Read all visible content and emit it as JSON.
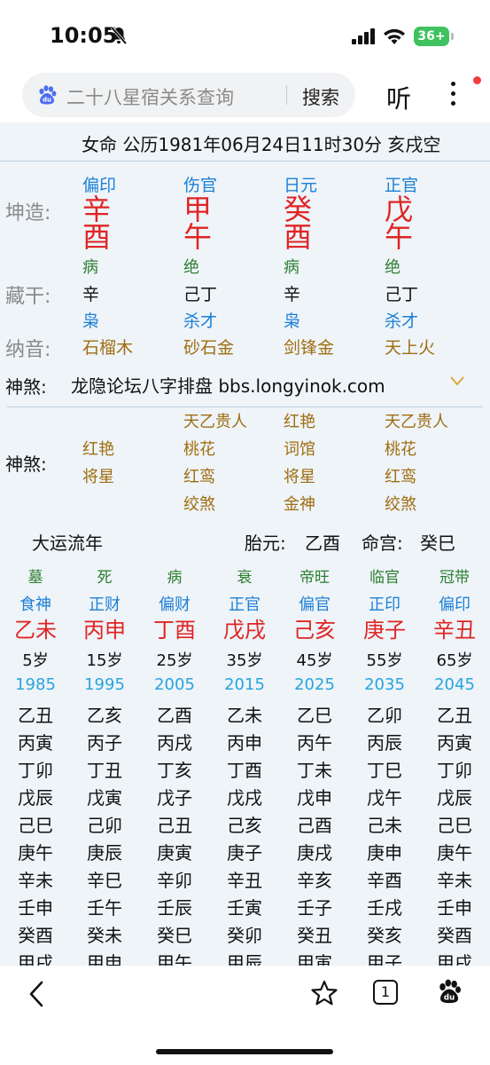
{
  "status": {
    "time": "10:05",
    "battery": "36+"
  },
  "browser": {
    "search_text": "二十八星宿关系查询",
    "search_btn": "搜索",
    "listen_btn": "听"
  },
  "header": "女命 公历1981年06月24日11时30分 亥戌空",
  "pillars": [
    {
      "ten_god": "偏印",
      "stem": "辛",
      "branch": "酉",
      "stage": "病",
      "hidden": "辛",
      "hidden_gods": "枭",
      "nayin": "石榴木"
    },
    {
      "ten_god": "伤官",
      "stem": "甲",
      "branch": "午",
      "stage": "绝",
      "hidden": "己丁",
      "hidden_gods": "杀才",
      "nayin": "砂石金"
    },
    {
      "ten_god": "日元",
      "stem": "癸",
      "branch": "酉",
      "stage": "病",
      "hidden": "辛",
      "hidden_gods": "枭",
      "nayin": "剑锋金"
    },
    {
      "ten_god": "正官",
      "stem": "戊",
      "branch": "午",
      "stage": "绝",
      "hidden": "己丁",
      "hidden_gods": "杀才",
      "nayin": "天上火"
    }
  ],
  "labels": {
    "kunzao": "坤造:",
    "canggan": "藏干:",
    "nayin": "纳音:",
    "shensha": "神煞:",
    "shensha2": "神煞:"
  },
  "shensha_line": "龙隐论坛八字排盘 bbs.longyinok.com",
  "shensha_cols": [
    [
      "红艳",
      "将星"
    ],
    [
      "天乙贵人",
      "桃花",
      "红鸾",
      "绞煞"
    ],
    [
      "红艳",
      "词馆",
      "将星",
      "金神"
    ],
    [
      "天乙贵人",
      "桃花",
      "红鸾",
      "绞煞"
    ]
  ],
  "dayun": {
    "title": "大运流年",
    "taiyuan_label": "胎元:",
    "taiyuan": "乙酉",
    "minggong_label": "命宫:",
    "minggong": "癸巳"
  },
  "dayun_cols": [
    {
      "stage": "墓",
      "god": "食神",
      "ganzhi": "乙未",
      "age": "5岁",
      "year": "1985",
      "years": [
        "乙丑",
        "丙寅",
        "丁卯",
        "戊辰",
        "己巳",
        "庚午",
        "辛未",
        "壬申",
        "癸酉",
        "甲戌"
      ]
    },
    {
      "stage": "死",
      "god": "正财",
      "ganzhi": "丙申",
      "age": "15岁",
      "year": "1995",
      "years": [
        "乙亥",
        "丙子",
        "丁丑",
        "戊寅",
        "己卯",
        "庚辰",
        "辛巳",
        "壬午",
        "癸未",
        "甲申"
      ]
    },
    {
      "stage": "病",
      "god": "偏财",
      "ganzhi": "丁酉",
      "age": "25岁",
      "year": "2005",
      "years": [
        "乙酉",
        "丙戌",
        "丁亥",
        "戊子",
        "己丑",
        "庚寅",
        "辛卯",
        "壬辰",
        "癸巳",
        "甲午"
      ]
    },
    {
      "stage": "衰",
      "god": "正官",
      "ganzhi": "戊戌",
      "age": "35岁",
      "year": "2015",
      "years": [
        "乙未",
        "丙申",
        "丁酉",
        "戊戌",
        "己亥",
        "庚子",
        "辛丑",
        "壬寅",
        "癸卯",
        "甲辰"
      ]
    },
    {
      "stage": "帝旺",
      "god": "偏官",
      "ganzhi": "己亥",
      "age": "45岁",
      "year": "2025",
      "years": [
        "乙巳",
        "丙午",
        "丁未",
        "戊申",
        "己酉",
        "庚戌",
        "辛亥",
        "壬子",
        "癸丑",
        "甲寅"
      ]
    },
    {
      "stage": "临官",
      "god": "正印",
      "ganzhi": "庚子",
      "age": "55岁",
      "year": "2035",
      "years": [
        "乙卯",
        "丙辰",
        "丁巳",
        "戊午",
        "己未",
        "庚申",
        "辛酉",
        "壬戌",
        "癸亥",
        "甲子"
      ]
    },
    {
      "stage": "冠带",
      "god": "偏印",
      "ganzhi": "辛丑",
      "age": "65岁",
      "year": "2045",
      "years": [
        "乙丑",
        "丙寅",
        "丁卯",
        "戊辰",
        "己巳",
        "庚午",
        "辛未",
        "壬申",
        "癸酉",
        "甲戌"
      ]
    }
  ],
  "tabs": {
    "tab_count": "1"
  },
  "colors": {
    "red": "#e02424",
    "blue": "#1d7fd6",
    "green": "#2e7d32",
    "gold": "#a06d10",
    "bg": "#eef4f8"
  }
}
